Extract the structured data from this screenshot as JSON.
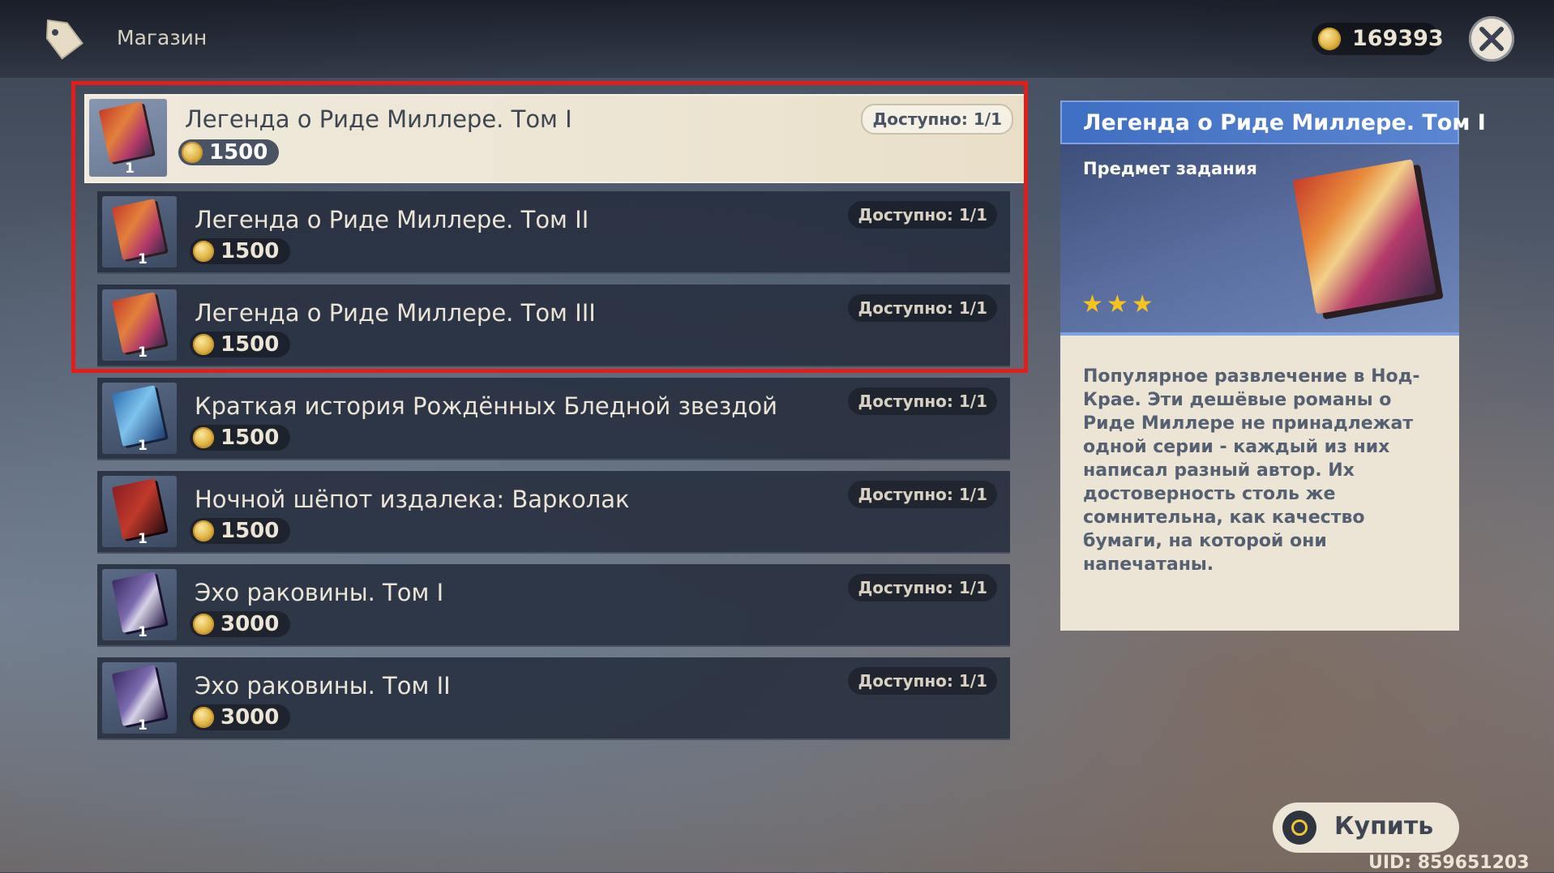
{
  "header": {
    "title": "Магазин",
    "currency_value": "169393"
  },
  "items": [
    {
      "title": "Легенда о Риде Миллере. Том I",
      "price": "1500",
      "available": "Доступно: 1/1",
      "qty": "1",
      "cover": "book-red"
    },
    {
      "title": "Легенда о Риде Миллере. Том II",
      "price": "1500",
      "available": "Доступно: 1/1",
      "qty": "1",
      "cover": "book-red"
    },
    {
      "title": "Легенда о Риде Миллере. Том III",
      "price": "1500",
      "available": "Доступно: 1/1",
      "qty": "1",
      "cover": "book-red"
    },
    {
      "title": "Краткая история Рождённых Бледной звездой",
      "price": "1500",
      "available": "Доступно: 1/1",
      "qty": "1",
      "cover": "book-blue"
    },
    {
      "title": "Ночной шёпот издалека: Варколак",
      "price": "1500",
      "available": "Доступно: 1/1",
      "qty": "1",
      "cover": "book-crimson"
    },
    {
      "title": "Эхо раковины. Том I",
      "price": "3000",
      "available": "Доступно: 1/1",
      "qty": "1",
      "cover": "book-purple"
    },
    {
      "title": "Эхо раковины. Том II",
      "price": "3000",
      "available": "Доступно: 1/1",
      "qty": "1",
      "cover": "book-purple"
    }
  ],
  "selected_index": 0,
  "detail": {
    "title": "Легенда о Риде Миллере. Том I",
    "type": "Предмет задания",
    "stars": "★★★",
    "description": "Популярное развлечение в Нод-Крае. Эти дешёвые романы о Риде Миллере не принадлежат одной серии - каждый из них написал разный автор. Их достоверность столь же сомнительна, как качество бумаги, на которой они напечатаны."
  },
  "buy_button": {
    "label": "Купить"
  },
  "uid": "UID: 859651203",
  "colors": {
    "highlight": "#e31c1c",
    "accent_blue": "#4a78c8",
    "parchment": "#ece5d6",
    "coin_gold": "#e2b84a"
  },
  "icons": {
    "shop": "price-tag-icon",
    "currency": "mora-coin-icon",
    "close": "close-icon",
    "buy": "controller-button-icon"
  }
}
